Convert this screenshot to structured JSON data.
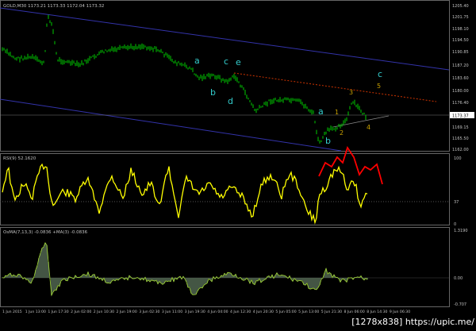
{
  "colors": {
    "background": "#000000",
    "price_bars": "#00cc00",
    "channel_lines": "#3333aa",
    "dotted_trend": "#cc3300",
    "wave_labels_cyan": "#33cccc",
    "wave_labels_gold": "#c8a000",
    "rsi_line": "#ffff00",
    "rsi_forecast": "#ff0000",
    "osma_histogram": "#556b55",
    "osma_signal": "#99cc33",
    "grid_text": "#c0c0c0",
    "current_price_box": "#ffffff"
  },
  "main_chart": {
    "title": "GOLD,M30  1173.21 1173.33 1172.04 1173.32",
    "price_axis": [
      "1205.40",
      "1201.75",
      "1198.10",
      "1194.50",
      "1190.85",
      "1187.20",
      "1183.60",
      "1180.00",
      "1176.40",
      "1173.37",
      "1169.15",
      "1165.50",
      "1162.00"
    ],
    "current_price": "1173.37",
    "wave_labels": [
      {
        "text": "a",
        "color": "cyan"
      },
      {
        "text": "b",
        "color": "cyan"
      },
      {
        "text": "c",
        "color": "cyan"
      },
      {
        "text": "d",
        "color": "cyan"
      },
      {
        "text": "e",
        "color": "cyan"
      },
      {
        "text": "a",
        "color": "cyan"
      },
      {
        "text": "b",
        "color": "cyan"
      },
      {
        "text": "c",
        "color": "cyan"
      },
      {
        "text": "1",
        "color": "gold"
      },
      {
        "text": "2",
        "color": "gold"
      },
      {
        "text": "3",
        "color": "gold"
      },
      {
        "text": "4",
        "color": "gold"
      },
      {
        "text": "5",
        "color": "gold"
      }
    ]
  },
  "rsi_panel": {
    "title": "RSI(9) 52.1620",
    "axis": [
      "100",
      "37",
      "0"
    ]
  },
  "osma_panel": {
    "title": "OsMA(7,13,3) -0.0836  +MA(3) -0.0836",
    "axis": [
      "1.3190",
      "0.00",
      "-0.707"
    ]
  },
  "time_axis": [
    "1 Jun 2015",
    "1 Jun 13:00",
    "1 Jun 17:30",
    "2 Jun 02:00",
    "2 Jun 10:30",
    "2 Jun 19:00",
    "3 Jun 02:30",
    "3 Jun 11:00",
    "3 Jun 19:30",
    "4 Jun 04:00",
    "4 Jun 12:30",
    "4 Jun 20:30",
    "5 Jun 05:00",
    "5 Jun 13:00",
    "5 Jun 21:30",
    "8 Jun 06:00",
    "8 Jun 14:30",
    "9 Jun 06:30"
  ],
  "watermark": "[1278x838] https://upic.me/"
}
